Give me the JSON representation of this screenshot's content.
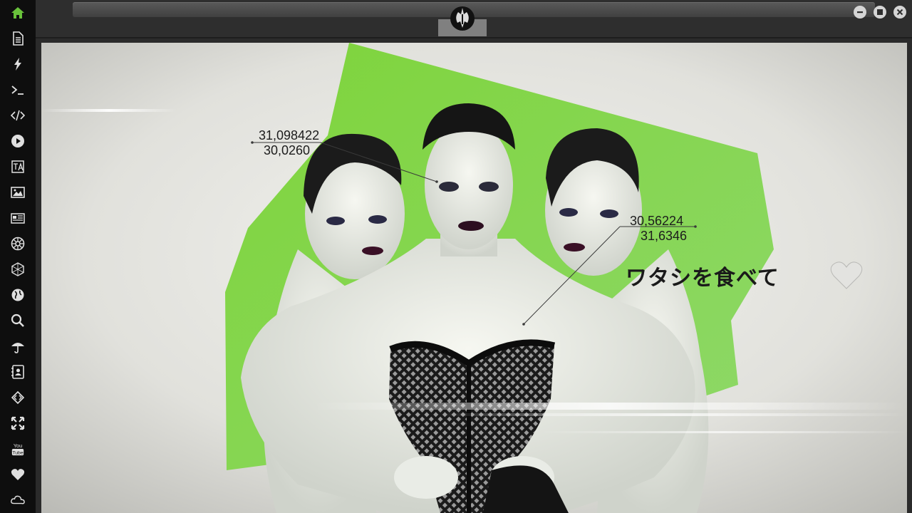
{
  "sidebar": {
    "items": [
      {
        "name": "home-icon",
        "color": "#69c23b"
      },
      {
        "name": "document-icon"
      },
      {
        "name": "lightning-icon"
      },
      {
        "name": "terminal-icon"
      },
      {
        "name": "code-icon"
      },
      {
        "name": "play-icon"
      },
      {
        "name": "translate-icon"
      },
      {
        "name": "image-icon"
      },
      {
        "name": "news-icon"
      },
      {
        "name": "empire-icon"
      },
      {
        "name": "hexagon-icon"
      },
      {
        "name": "globe-icon"
      },
      {
        "name": "search-icon"
      },
      {
        "name": "umbrella-icon"
      },
      {
        "name": "contacts-icon"
      },
      {
        "name": "diamond-code-icon"
      },
      {
        "name": "expand-icon"
      },
      {
        "name": "youtube-icon",
        "label_top": "You",
        "label_bottom": "Tube"
      },
      {
        "name": "heart-icon"
      },
      {
        "name": "cloud-icon"
      }
    ]
  },
  "window_controls": [
    "minimize",
    "maximize",
    "close"
  ],
  "tab": {
    "icon": "rebel-alliance-icon"
  },
  "content": {
    "coords_left": {
      "line1": "31,098422",
      "line2": "30,0260"
    },
    "coords_right": {
      "line1": "30,56224",
      "line2": "31,6346"
    },
    "caption": "ワタシを食べて",
    "accent_green": "#7ed43a"
  }
}
